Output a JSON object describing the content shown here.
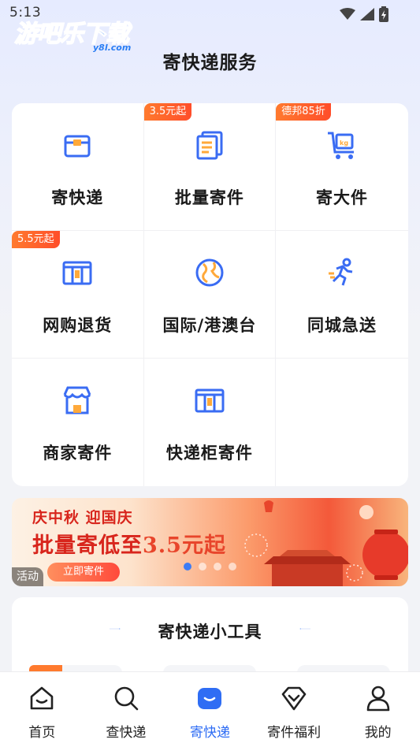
{
  "status": {
    "time": "5:13"
  },
  "watermark": {
    "main": "游吧乐下载",
    "sub": "y8l.com"
  },
  "page": {
    "title": "寄快递服务"
  },
  "services": [
    {
      "label": "寄快递",
      "tag": ""
    },
    {
      "label": "批量寄件",
      "tag": "3.5元起"
    },
    {
      "label": "寄大件",
      "tag": "德邦85折"
    },
    {
      "label": "网购退货",
      "tag": "5.5元起"
    },
    {
      "label": "国际/港澳台",
      "tag": ""
    },
    {
      "label": "同城急送",
      "tag": ""
    },
    {
      "label": "商家寄件",
      "tag": ""
    },
    {
      "label": "快递柜寄件",
      "tag": ""
    }
  ],
  "icons": {
    "send": "box-icon",
    "batch": "documents-icon",
    "bulky": "cart-kg-icon",
    "return": "locker-icon",
    "international": "globe-icon",
    "sameday": "runner-icon",
    "merchant": "shop-icon",
    "locker": "locker-icon"
  },
  "banner": {
    "line1": "庆中秋  迎国庆",
    "line2_prefix": "批量寄低至",
    "line2_price": "3.5元起",
    "button": "立即寄件",
    "activity_badge": "活动",
    "page_index": 1,
    "page_count": 4
  },
  "tools": {
    "title": "寄快递小工具"
  },
  "tabbar": {
    "items": [
      {
        "label": "首页",
        "icon": "home-icon"
      },
      {
        "label": "查快递",
        "icon": "search-icon"
      },
      {
        "label": "寄快递",
        "icon": "send-bag-icon"
      },
      {
        "label": "寄件福利",
        "icon": "diamond-icon"
      },
      {
        "label": "我的",
        "icon": "profile-icon"
      }
    ],
    "active_index": 2
  },
  "colors": {
    "accent": "#2f6df4",
    "tag": "#ff5a2c",
    "banner_red": "#d8251c"
  }
}
